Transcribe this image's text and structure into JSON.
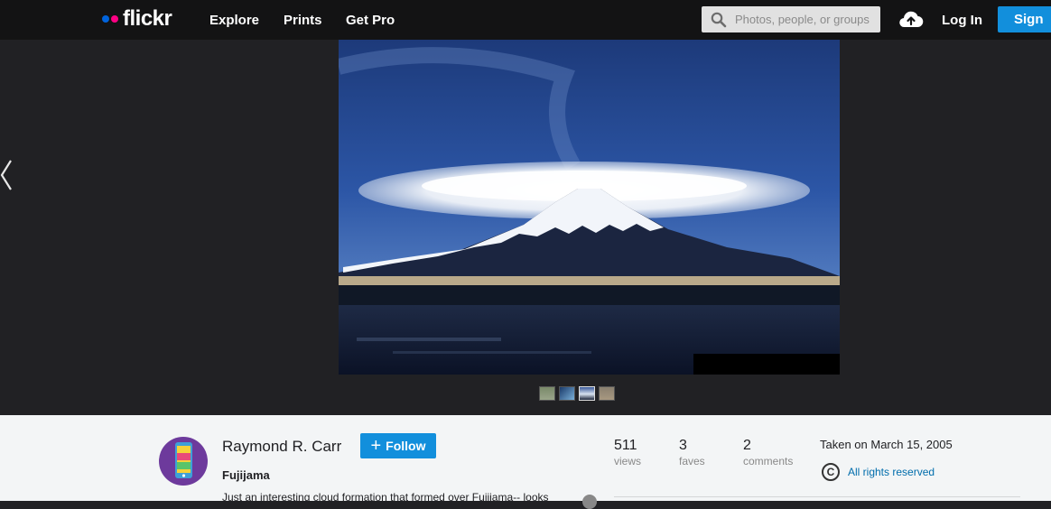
{
  "brand": {
    "name": "flickr"
  },
  "nav": {
    "explore": "Explore",
    "prints": "Prints",
    "get_pro": "Get Pro"
  },
  "search": {
    "placeholder": "Photos, people, or groups"
  },
  "header": {
    "login": "Log In",
    "signup": "Sign Up"
  },
  "photo": {
    "thumbnail_count": 4
  },
  "owner": {
    "name": "Raymond R. Carr",
    "follow_label": "Follow"
  },
  "photo_info": {
    "title": "Fujijama",
    "description": "Just an interesting cloud formation that formed over Fujijama-- looks"
  },
  "stats": {
    "views": {
      "value": "511",
      "label": "views"
    },
    "faves": {
      "value": "3",
      "label": "faves"
    },
    "comments": {
      "value": "2",
      "label": "comments"
    }
  },
  "meta": {
    "taken": "Taken on March 15, 2005",
    "rights": "All rights reserved"
  },
  "colors": {
    "accent": "#128fdc",
    "brand_blue": "#0063dc",
    "brand_pink": "#ff0084",
    "topbar": "#131314",
    "stage": "#212124"
  },
  "icons": {
    "search": "search-icon",
    "upload": "upload-cloud-icon",
    "prev": "chevron-left-icon",
    "copyright": "copyright-icon"
  }
}
